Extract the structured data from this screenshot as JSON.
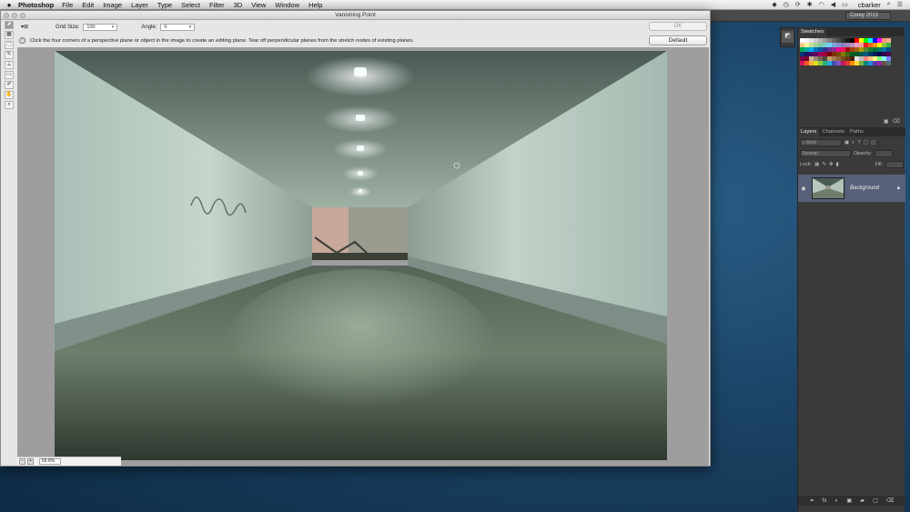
{
  "menubar": {
    "app_name": "Photoshop",
    "items": [
      "File",
      "Edit",
      "Image",
      "Layer",
      "Type",
      "Select",
      "Filter",
      "3D",
      "View",
      "Window",
      "Help"
    ],
    "user": "cbarker"
  },
  "dialog": {
    "title": "Vanishing Point",
    "grid_size_label": "Grid Size:",
    "grid_size_value": "100",
    "angle_label": "Angle:",
    "angle_value": "0",
    "ok_label": "OK",
    "default_label": "Default",
    "info_text": "Click the four corners of a perspective plane or object in the image to create an editing plane. Tear off perpendicular planes from the stretch nodes of existing planes.",
    "zoom": "66.8%",
    "tools": [
      "⬈",
      "▦",
      "⬚",
      "✎",
      "⟂",
      "▭",
      "✐",
      "✋",
      "⌕"
    ]
  },
  "workspace": {
    "name": "Corey 2013"
  },
  "swatches": {
    "tab": "Swatches",
    "colors": [
      "#ffffff",
      "#f2f2f2",
      "#e0e0e0",
      "#cccccc",
      "#b3b3b3",
      "#999999",
      "#808080",
      "#666666",
      "#4d4d4d",
      "#333333",
      "#1a1a1a",
      "#000000",
      "#ff0000",
      "#ffff00",
      "#00ff00",
      "#00ffff",
      "#0000ff",
      "#ff00ff",
      "#f7977a",
      "#f9ad81",
      "#fdc68a",
      "#fff79a",
      "#c4df9b",
      "#a2d39c",
      "#82ca9d",
      "#7bcdc8",
      "#6ecff6",
      "#7ea7d8",
      "#8493ca",
      "#8882be",
      "#a187be",
      "#bc8dbf",
      "#f49ac2",
      "#f6989d",
      "#ed1c24",
      "#f26522",
      "#f7941d",
      "#fff200",
      "#8dc63f",
      "#39b54a",
      "#00a651",
      "#00a99d",
      "#00aeef",
      "#0072bc",
      "#0054a6",
      "#2e3192",
      "#662d91",
      "#92278f",
      "#ec008c",
      "#ed145b",
      "#9e0b0f",
      "#a0410d",
      "#a36209",
      "#aba000",
      "#598527",
      "#1a7b30",
      "#007236",
      "#00746b",
      "#0076a3",
      "#004b80",
      "#003471",
      "#1b1464",
      "#440e62",
      "#630460",
      "#9e005d",
      "#9e0039",
      "#790000",
      "#7b2e00",
      "#7d4900",
      "#827b00",
      "#406618",
      "#005e20",
      "#005826",
      "#005952",
      "#005b7f",
      "#003663",
      "#002157",
      "#0d004c",
      "#32004b",
      "#4b0049",
      "#7b0046",
      "#7a0026",
      "#c7b299",
      "#998675",
      "#736357",
      "#534741",
      "#c69c6d",
      "#a67c52",
      "#8c6239",
      "#754c24",
      "#603913",
      "#42210b",
      "#e6e6e6",
      "#bdbdbd",
      "#ff8080",
      "#ffbf80",
      "#ffff80",
      "#80ff80",
      "#80ffff",
      "#8080ff",
      "#d4145a",
      "#f15a24",
      "#fbb03b",
      "#d9e021",
      "#8cc63f",
      "#22b573",
      "#29abe2",
      "#3f51b5",
      "#7e57c2",
      "#c2185b",
      "#e53935",
      "#fb8c00",
      "#fdd835",
      "#7cb342",
      "#00897b",
      "#1e88e5",
      "#5e35b1",
      "#8e24aa",
      "#6d4c41",
      "#546e7a"
    ]
  },
  "layers": {
    "tabs": [
      "Layers",
      "Channels",
      "Paths"
    ],
    "kind_label": "Kind",
    "blend_mode": "Normal",
    "opacity_label": "Opacity:",
    "lock_label": "Lock:",
    "fill_label": "Fill:",
    "layer_name": "Background",
    "footer_icons": [
      "fx",
      "◐",
      "▣",
      "▢",
      "⌫"
    ]
  }
}
